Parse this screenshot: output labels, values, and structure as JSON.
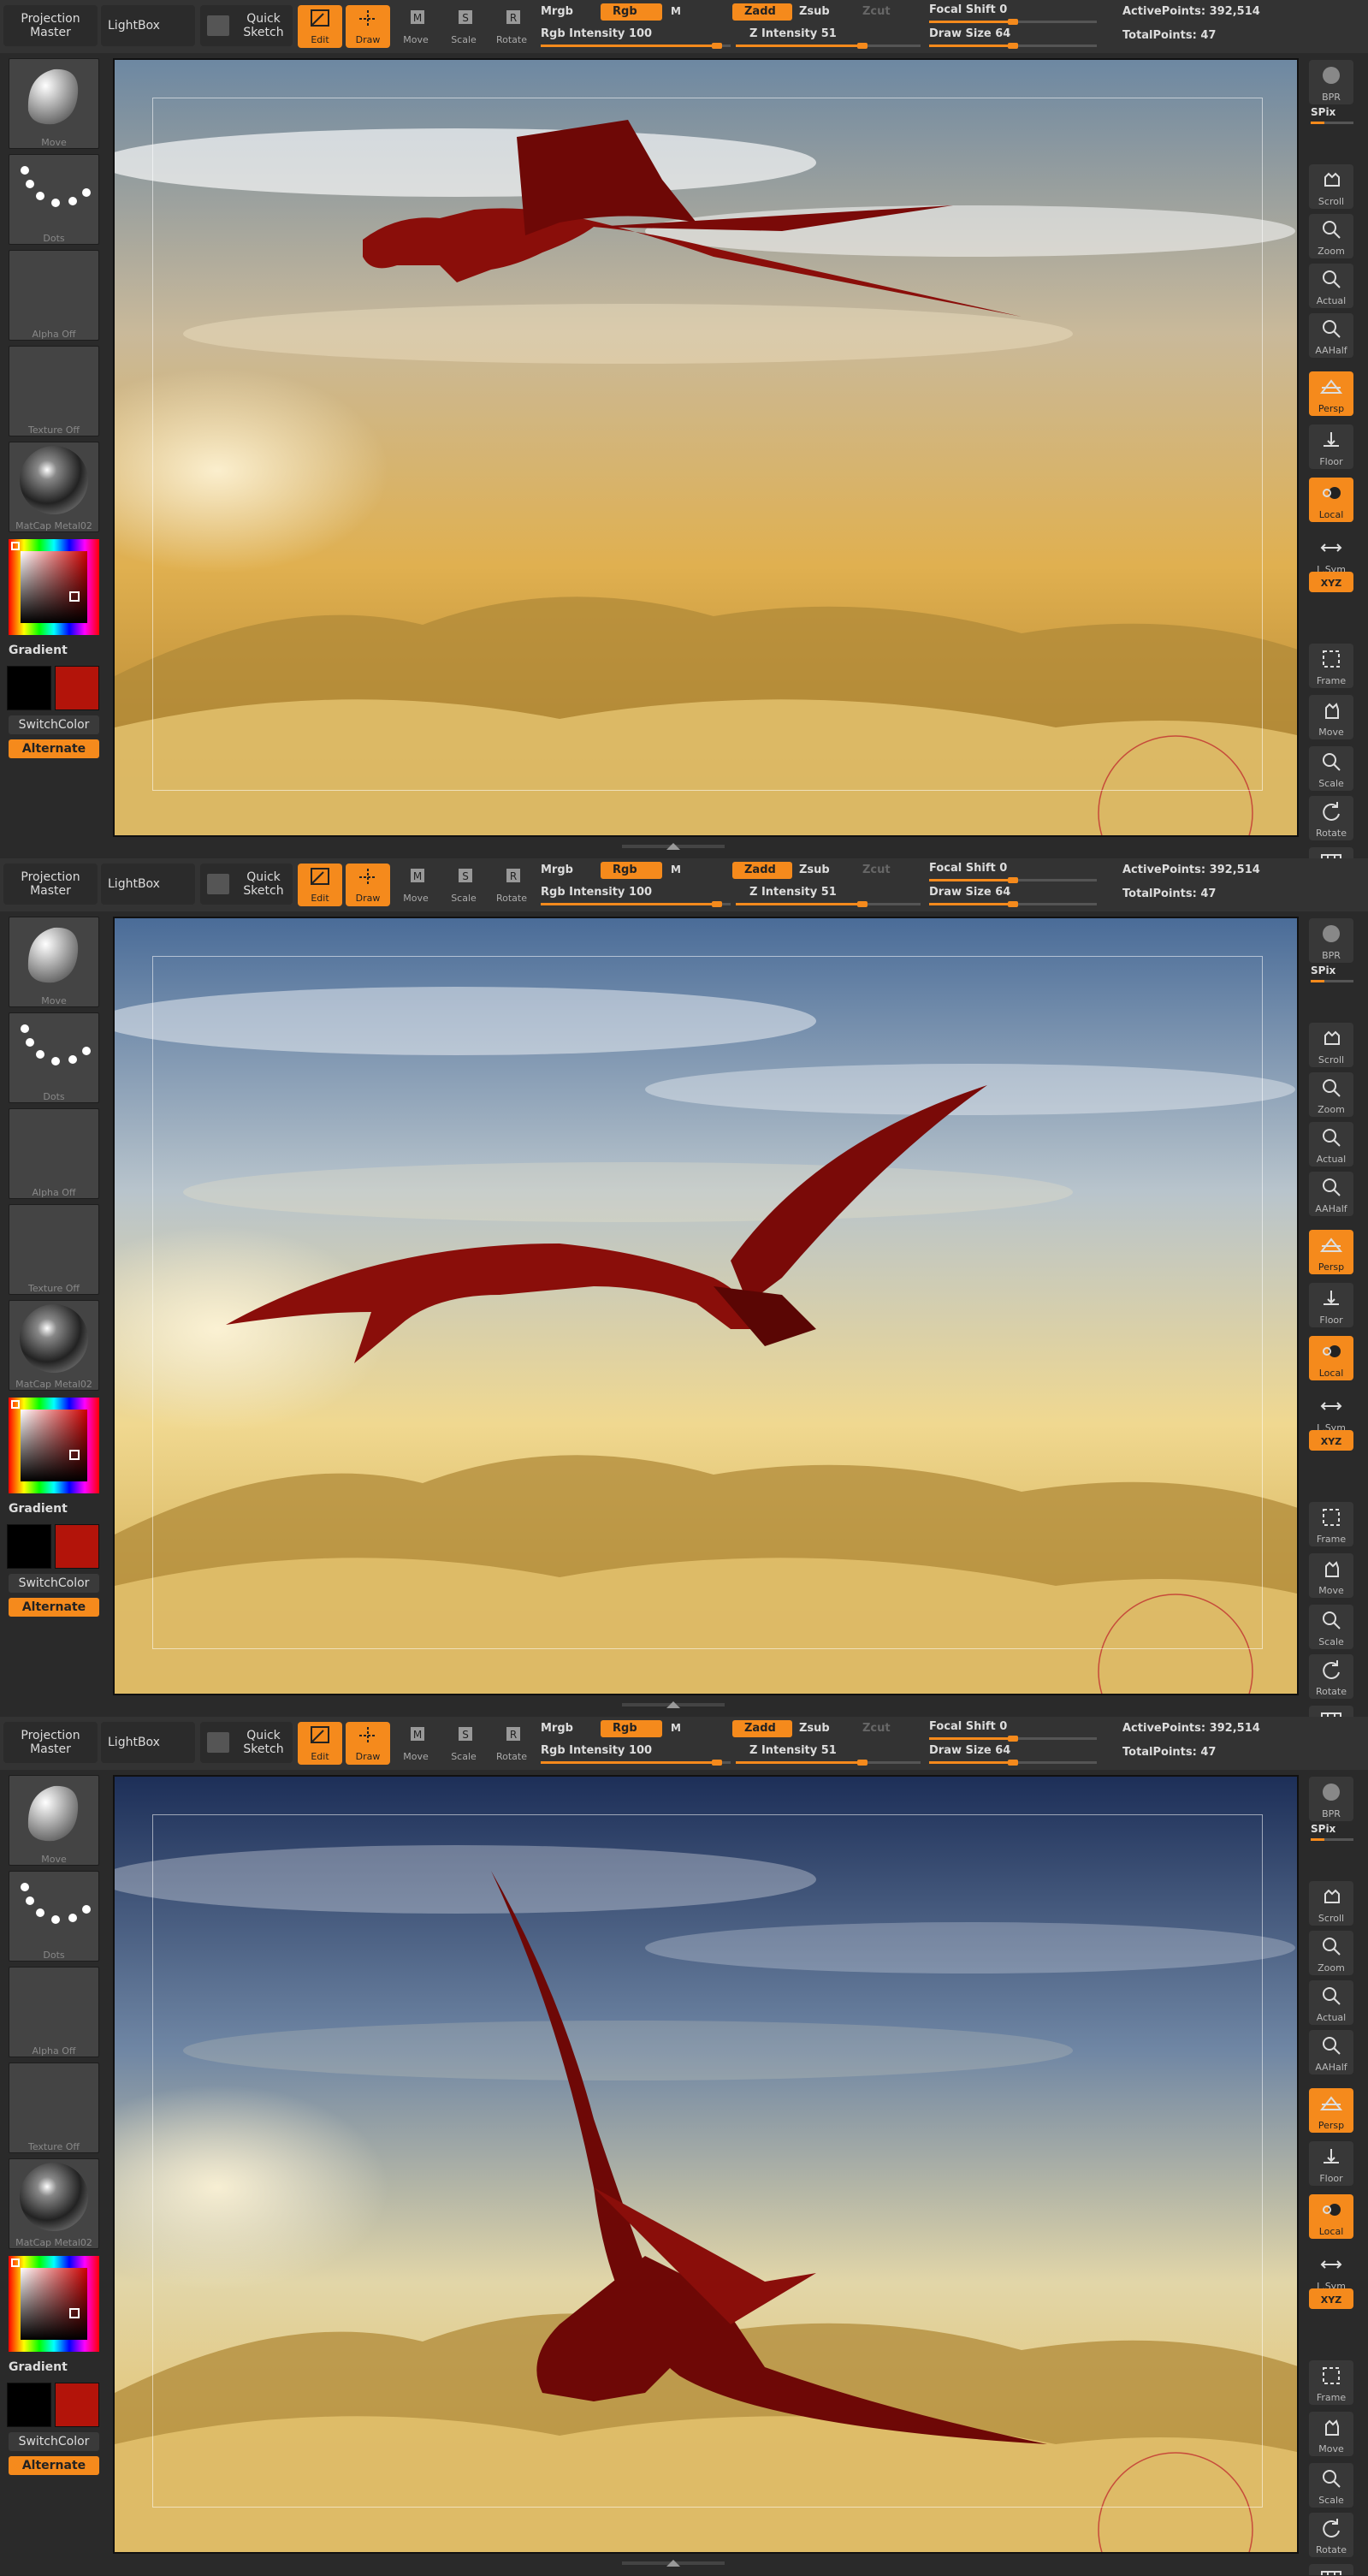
{
  "toolbar": {
    "projection_master": "Projection Master",
    "lightbox": "LightBox",
    "quick_sketch": "Quick Sketch",
    "edit": "Edit",
    "draw": "Draw",
    "move": "Move",
    "scale": "Scale",
    "rotate": "Rotate",
    "mrgb": "Mrgb",
    "rgb": "Rgb",
    "m": "M",
    "rgb_intensity_label": "Rgb Intensity",
    "rgb_intensity_value": "100",
    "zadd": "Zadd",
    "zsub": "Zsub",
    "zcut": "Zcut",
    "z_intensity_label": "Z Intensity",
    "z_intensity_value": "51",
    "focal_shift_label": "Focal Shift",
    "focal_shift_value": "0",
    "draw_size_label": "Draw Size",
    "draw_size_value": "64",
    "active_points": "ActivePoints: 392,514",
    "total_points": "TotalPoints: 47"
  },
  "left_panel": {
    "brush_label": "Move",
    "stroke_label": "Dots",
    "alpha_label": "Alpha  Off",
    "texture_label": "Texture  Off",
    "material_label": "MatCap  Metal02",
    "gradient": "Gradient",
    "switch_color": "SwitchColor",
    "alternate": "Alternate",
    "main_color": "#000000",
    "secondary_color": "#b3140a"
  },
  "right_panel": {
    "items": [
      {
        "label": "BPR",
        "icon": "bpr-icon",
        "on": false
      },
      {
        "label": "Scroll",
        "icon": "scroll-icon",
        "on": false
      },
      {
        "label": "Zoom",
        "icon": "zoom-icon",
        "on": false
      },
      {
        "label": "Actual",
        "icon": "actual-icon",
        "on": false
      },
      {
        "label": "AAHalf",
        "icon": "aahalf-icon",
        "on": false
      },
      {
        "label": "Persp",
        "icon": "persp-icon",
        "on": true
      },
      {
        "label": "Floor",
        "icon": "floor-icon",
        "on": false
      },
      {
        "label": "Local",
        "icon": "local-icon",
        "on": true
      },
      {
        "label": "L.Sym",
        "icon": "lsym-icon",
        "on": false
      },
      {
        "label": "XYZ",
        "icon": "xyz-icon",
        "on": true
      },
      {
        "label": "Frame",
        "icon": "frame-icon",
        "on": false
      },
      {
        "label": "Move",
        "icon": "move-icon",
        "on": false
      },
      {
        "label": "Scale",
        "icon": "scale-icon",
        "on": false
      },
      {
        "label": "Rotate",
        "icon": "rotate-icon",
        "on": false
      },
      {
        "label": "PolyF",
        "icon": "polyf-icon",
        "on": false
      }
    ],
    "spix_label": "SPix"
  },
  "accent_color": "#f58a1c",
  "panels": [
    {
      "name": "panel-1",
      "scene": "dragon gliding over clouds"
    },
    {
      "name": "panel-2",
      "scene": "dragon banking over mountains"
    },
    {
      "name": "panel-3",
      "scene": "dragon rising into sky"
    }
  ]
}
